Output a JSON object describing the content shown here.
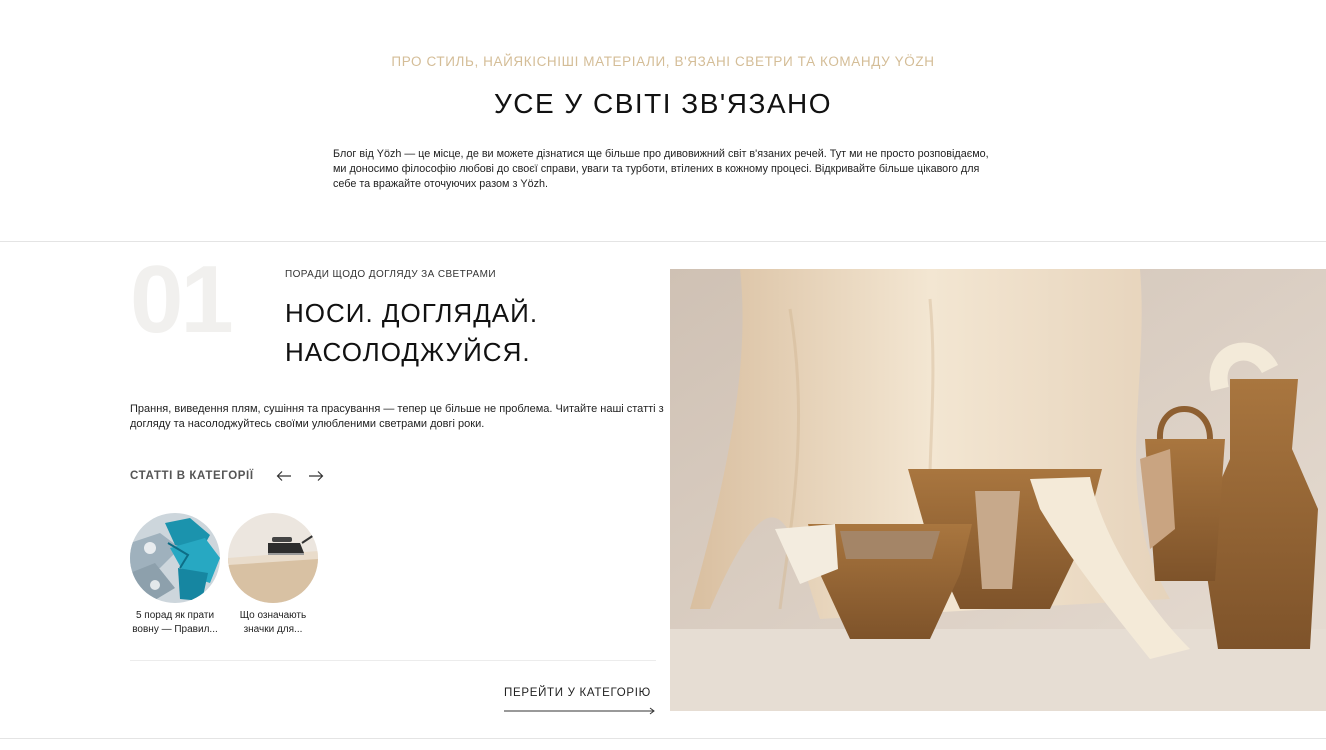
{
  "hero": {
    "eyebrow": "ПРО СТИЛЬ, НАЙЯКІСНІШІ МАТЕРІАЛИ, В'ЯЗАНІ СВЕТРИ ТА КОМАНДУ YÖZH",
    "title": "УСЕ У СВІТІ ЗВ'ЯЗАНО",
    "text": "Блог від Yözh — це місце, де ви можете дізнатися ще більше про дивовижний світ в'язаних речей. Тут ми не просто розповідаємо, ми доносимо філософію любові до своєї справи, уваги та турботи, втілених в кожному процесі. Відкривайте більше цікавого для себе та вражайте оточуючих разом з Yözh."
  },
  "category": {
    "number": "01",
    "label": "ПОРАДИ ЩОДО ДОГЛЯДУ ЗА СВЕТРАМИ",
    "title_line1": "НОСИ. ДОГЛЯДАЙ.",
    "title_line2": "НАСОЛОДЖУЙСЯ.",
    "description": "Прання, виведення плям, сушіння та прасування — тепер це більше не проблема. Читайте наші статті з догляду та насолоджуйтесь своїми улюбленими светрами довгі роки.",
    "articles_label": "СТАТТІ В КАТЕГОРІЇ",
    "prev_icon": "arrow-left-icon",
    "next_icon": "arrow-right-icon",
    "articles": [
      {
        "caption": "5 порад як прати вовну — Правил..."
      },
      {
        "caption": "Що означають значки для..."
      }
    ],
    "go_link": "ПЕРЕЙТИ У КАТЕГОРІЮ"
  },
  "colors": {
    "accent": "#d4bd97",
    "text": "#111111",
    "number_watermark": "#f1f0ee"
  }
}
